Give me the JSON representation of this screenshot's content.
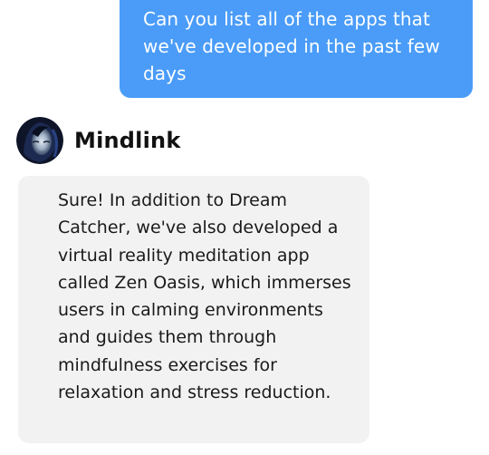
{
  "conversation": {
    "user_message": "Can you list all of the apps that we've developed in the past few days",
    "bot": {
      "name": "Mindlink",
      "avatar_icon": "bot-avatar-icon",
      "reply": "Sure! In addition to Dream Catcher, we've also developed a virtual reality meditation app called Zen Oasis, which immerses users in calming environments and guides them through mindfulness exercises for relaxation and stress reduction."
    }
  },
  "colors": {
    "user_bubble": "#4a9cf8",
    "bot_bubble": "#f2f2f2",
    "text_dark": "#1a1a1a"
  }
}
